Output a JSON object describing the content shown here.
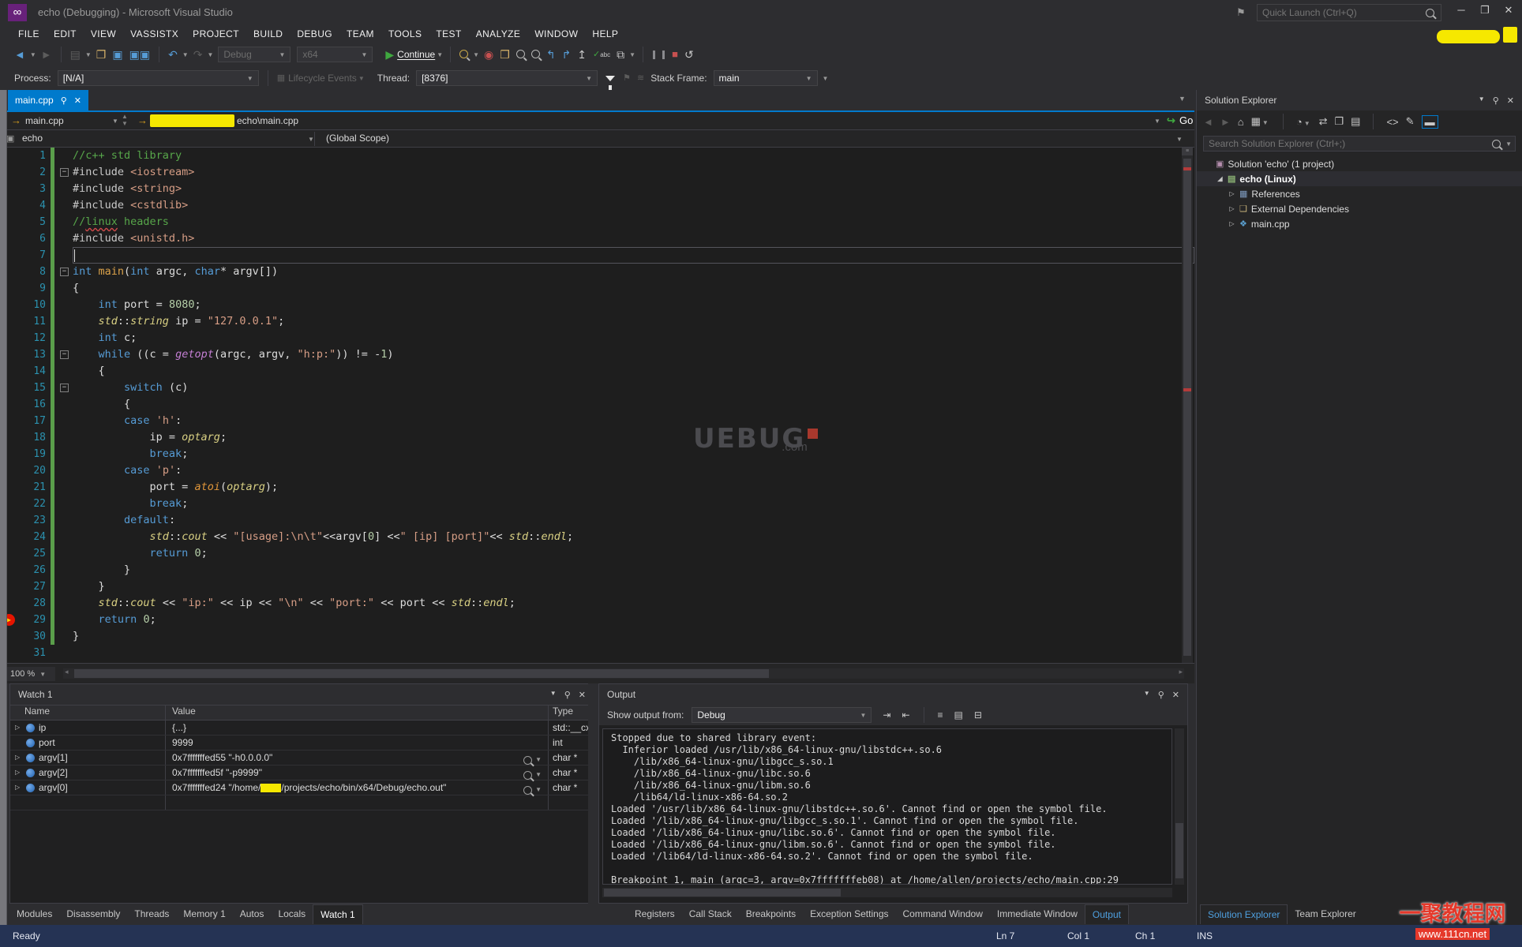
{
  "window": {
    "title": "echo (Debugging) - Microsoft Visual Studio",
    "quick_launch_placeholder": "Quick Launch (Ctrl+Q)"
  },
  "menu": [
    "FILE",
    "EDIT",
    "VIEW",
    "VASSISTX",
    "PROJECT",
    "BUILD",
    "DEBUG",
    "TEAM",
    "TOOLS",
    "TEST",
    "ANALYZE",
    "WINDOW",
    "HELP"
  ],
  "toolbar": {
    "configuration": "Debug",
    "platform": "x64",
    "continue_label": "Continue"
  },
  "debug_bar": {
    "process_label": "Process:",
    "process_value": "[N/A]",
    "lifecycle_label": "Lifecycle Events",
    "thread_label": "Thread:",
    "thread_value": "[8376]",
    "stack_frame_label": "Stack Frame:",
    "stack_frame_value": "main"
  },
  "editor": {
    "tab_label": "main.cpp",
    "nav_file": "main.cpp",
    "nav_path_suffix": "echo\\main.cpp",
    "scope_project": "echo",
    "scope_global": "(Global Scope)",
    "go_label": "Go",
    "zoom_level": "100 %",
    "lines": [
      {
        "n": 1,
        "t": [
          [
            "cm",
            "//c++ std library"
          ]
        ]
      },
      {
        "n": 2,
        "fold": true,
        "t": [
          [
            "pp",
            "#include "
          ],
          [
            "str",
            "<iostream>"
          ]
        ]
      },
      {
        "n": 3,
        "t": [
          [
            "pp",
            "#include "
          ],
          [
            "str",
            "<string>"
          ]
        ]
      },
      {
        "n": 4,
        "t": [
          [
            "pp",
            "#include "
          ],
          [
            "str",
            "<cstdlib>"
          ]
        ]
      },
      {
        "n": 5,
        "t": [
          [
            "cm",
            "//"
          ],
          [
            "cmsq",
            "linux"
          ],
          [
            "cm",
            " headers"
          ]
        ]
      },
      {
        "n": 6,
        "t": [
          [
            "pp",
            "#include "
          ],
          [
            "str",
            "<unistd.h>"
          ]
        ]
      },
      {
        "n": 7,
        "cur": true,
        "t": []
      },
      {
        "n": 8,
        "fold": true,
        "t": [
          [
            "kw",
            "int "
          ],
          [
            "fn",
            "main"
          ],
          [
            "pl",
            "("
          ],
          [
            "kw",
            "int"
          ],
          [
            "pl",
            " argc, "
          ],
          [
            "kw",
            "char"
          ],
          [
            "pl",
            "* argv[])"
          ]
        ]
      },
      {
        "n": 9,
        "t": [
          [
            "pl",
            "{"
          ]
        ]
      },
      {
        "n": 10,
        "t": [
          [
            "pl",
            "    "
          ],
          [
            "kw",
            "int"
          ],
          [
            "pl",
            " port = "
          ],
          [
            "num",
            "8080"
          ],
          [
            "pl",
            ";"
          ]
        ]
      },
      {
        "n": 11,
        "t": [
          [
            "pl",
            "    "
          ],
          [
            "va",
            "std"
          ],
          [
            "pl",
            "::"
          ],
          [
            "va",
            "string"
          ],
          [
            "pl",
            " ip = "
          ],
          [
            "str",
            "\"127.0.0.1\""
          ],
          [
            "pl",
            ";"
          ]
        ]
      },
      {
        "n": 12,
        "t": [
          [
            "pl",
            "    "
          ],
          [
            "kw",
            "int"
          ],
          [
            "pl",
            " c;"
          ]
        ]
      },
      {
        "n": 13,
        "fold": true,
        "t": [
          [
            "pl",
            "    "
          ],
          [
            "kw",
            "while"
          ],
          [
            "pl",
            " ((c = "
          ],
          [
            "mg",
            "getopt"
          ],
          [
            "pl",
            "(argc, argv, "
          ],
          [
            "str",
            "\"h:p:\""
          ],
          [
            "pl",
            ")) != -"
          ],
          [
            "num",
            "1"
          ],
          [
            "pl",
            ")"
          ]
        ]
      },
      {
        "n": 14,
        "t": [
          [
            "pl",
            "    {"
          ]
        ]
      },
      {
        "n": 15,
        "fold": true,
        "t": [
          [
            "pl",
            "        "
          ],
          [
            "kw",
            "switch"
          ],
          [
            "pl",
            " (c)"
          ]
        ]
      },
      {
        "n": 16,
        "t": [
          [
            "pl",
            "        {"
          ]
        ]
      },
      {
        "n": 17,
        "t": [
          [
            "pl",
            "        "
          ],
          [
            "kw",
            "case"
          ],
          [
            "pl",
            " "
          ],
          [
            "str",
            "'h'"
          ],
          [
            "pl",
            ":"
          ]
        ]
      },
      {
        "n": 18,
        "t": [
          [
            "pl",
            "            ip = "
          ],
          [
            "va",
            "optarg"
          ],
          [
            "pl",
            ";"
          ]
        ]
      },
      {
        "n": 19,
        "t": [
          [
            "pl",
            "            "
          ],
          [
            "kw",
            "break"
          ],
          [
            "pl",
            ";"
          ]
        ]
      },
      {
        "n": 20,
        "t": [
          [
            "pl",
            "        "
          ],
          [
            "kw",
            "case"
          ],
          [
            "pl",
            " "
          ],
          [
            "str",
            "'p'"
          ],
          [
            "pl",
            ":"
          ]
        ]
      },
      {
        "n": 21,
        "t": [
          [
            "pl",
            "            port = "
          ],
          [
            "or",
            "atoi"
          ],
          [
            "pl",
            "("
          ],
          [
            "va",
            "optarg"
          ],
          [
            "pl",
            ");"
          ]
        ]
      },
      {
        "n": 22,
        "t": [
          [
            "pl",
            "            "
          ],
          [
            "kw",
            "break"
          ],
          [
            "pl",
            ";"
          ]
        ]
      },
      {
        "n": 23,
        "t": [
          [
            "pl",
            "        "
          ],
          [
            "kw",
            "default"
          ],
          [
            "pl",
            ":"
          ]
        ]
      },
      {
        "n": 24,
        "t": [
          [
            "pl",
            "            "
          ],
          [
            "va",
            "std"
          ],
          [
            "pl",
            "::"
          ],
          [
            "va",
            "cout"
          ],
          [
            "pl",
            " << "
          ],
          [
            "str",
            "\"[usage]:\\n\\t\""
          ],
          [
            "pl",
            "<<argv["
          ],
          [
            "num",
            "0"
          ],
          [
            "pl",
            "] <<"
          ],
          [
            "str",
            "\" [ip] [port]\""
          ],
          [
            "pl",
            "<< "
          ],
          [
            "va",
            "std"
          ],
          [
            "pl",
            "::"
          ],
          [
            "va",
            "endl"
          ],
          [
            "pl",
            ";"
          ]
        ]
      },
      {
        "n": 25,
        "t": [
          [
            "pl",
            "            "
          ],
          [
            "kw",
            "return"
          ],
          [
            "pl",
            " "
          ],
          [
            "num",
            "0"
          ],
          [
            "pl",
            ";"
          ]
        ]
      },
      {
        "n": 26,
        "t": [
          [
            "pl",
            "        }"
          ]
        ]
      },
      {
        "n": 27,
        "t": [
          [
            "pl",
            "    }"
          ]
        ]
      },
      {
        "n": 28,
        "t": [
          [
            "pl",
            "    "
          ],
          [
            "va",
            "std"
          ],
          [
            "pl",
            "::"
          ],
          [
            "va",
            "cout"
          ],
          [
            "pl",
            " << "
          ],
          [
            "str",
            "\"ip:\""
          ],
          [
            "pl",
            " << ip << "
          ],
          [
            "str",
            "\"\\n\""
          ],
          [
            "pl",
            " << "
          ],
          [
            "str",
            "\"port:\""
          ],
          [
            "pl",
            " << port << "
          ],
          [
            "va",
            "std"
          ],
          [
            "pl",
            "::"
          ],
          [
            "va",
            "endl"
          ],
          [
            "pl",
            ";"
          ]
        ]
      },
      {
        "n": 29,
        "bp": true,
        "t": [
          [
            "pl",
            "    "
          ],
          [
            "kw",
            "return"
          ],
          [
            "pl",
            " "
          ],
          [
            "num",
            "0"
          ],
          [
            "pl",
            ";"
          ]
        ]
      },
      {
        "n": 30,
        "t": [
          [
            "pl",
            "}"
          ]
        ]
      },
      {
        "n": 31,
        "t": []
      }
    ]
  },
  "center_watermark": {
    "brand": "UEBUG",
    "suffix": ".com"
  },
  "watch": {
    "title": "Watch 1",
    "columns": [
      "Name",
      "Value",
      "Type"
    ],
    "rows": [
      {
        "expand": true,
        "name": "ip",
        "value": [
          {
            "t": "{...}"
          }
        ],
        "type": "std::__cx"
      },
      {
        "expand": false,
        "name": "port",
        "value": [
          {
            "t": "9999"
          }
        ],
        "type": "int"
      },
      {
        "expand": true,
        "name": "argv[1]",
        "value": [
          {
            "t": "0x7fffffffed55 \"-h0.0.0.0\""
          }
        ],
        "type": "char *",
        "mag": true
      },
      {
        "expand": true,
        "name": "argv[2]",
        "value": [
          {
            "t": "0x7fffffffed5f \"-p9999\""
          }
        ],
        "type": "char *",
        "mag": true
      },
      {
        "expand": true,
        "name": "argv[0]",
        "value": [
          {
            "t": "0x7fffffffed24 \"/home/"
          },
          {
            "redact": true
          },
          {
            "t": "/projects/echo/bin/x64/Debug/echo.out\""
          }
        ],
        "type": "char *",
        "mag": true
      }
    ]
  },
  "output": {
    "title": "Output",
    "show_output_label": "Show output from:",
    "source": "Debug",
    "lines": [
      "Stopped due to shared library event:",
      "  Inferior loaded /usr/lib/x86_64-linux-gnu/libstdc++.so.6",
      "    /lib/x86_64-linux-gnu/libgcc_s.so.1",
      "    /lib/x86_64-linux-gnu/libc.so.6",
      "    /lib/x86_64-linux-gnu/libm.so.6",
      "    /lib64/ld-linux-x86-64.so.2",
      "Loaded '/usr/lib/x86_64-linux-gnu/libstdc++.so.6'. Cannot find or open the symbol file.",
      "Loaded '/lib/x86_64-linux-gnu/libgcc_s.so.1'. Cannot find or open the symbol file.",
      "Loaded '/lib/x86_64-linux-gnu/libc.so.6'. Cannot find or open the symbol file.",
      "Loaded '/lib/x86_64-linux-gnu/libm.so.6'. Cannot find or open the symbol file.",
      "Loaded '/lib64/ld-linux-x86-64.so.2'. Cannot find or open the symbol file.",
      "",
      "Breakpoint 1, main (argc=3, argv=0x7fffffffeb08) at /home/allen/projects/echo/main.cpp:29"
    ]
  },
  "panel_tabs": {
    "left": [
      {
        "label": "Modules"
      },
      {
        "label": "Disassembly"
      },
      {
        "label": "Threads"
      },
      {
        "label": "Memory 1"
      },
      {
        "label": "Autos"
      },
      {
        "label": "Locals"
      },
      {
        "label": "Watch 1",
        "active": true
      }
    ],
    "middle": [
      {
        "label": "Registers"
      },
      {
        "label": "Call Stack"
      },
      {
        "label": "Breakpoints"
      },
      {
        "label": "Exception Settings"
      },
      {
        "label": "Command Window"
      },
      {
        "label": "Immediate Window"
      },
      {
        "label": "Output",
        "active": true
      }
    ],
    "right": [
      {
        "label": "Solution Explorer",
        "active": true
      },
      {
        "label": "Team Explorer"
      }
    ]
  },
  "solution_explorer": {
    "title": "Solution Explorer",
    "search_placeholder": "Search Solution Explorer (Ctrl+;)",
    "tree": [
      {
        "label": "Solution 'echo' (1 project)",
        "icon": "solution",
        "indent": 0
      },
      {
        "label": "echo (Linux)",
        "icon": "project",
        "indent": 1,
        "expanded": true,
        "bold": true
      },
      {
        "label": "References",
        "icon": "references",
        "indent": 2,
        "collapsible": true
      },
      {
        "label": "External Dependencies",
        "icon": "folder",
        "indent": 2,
        "collapsible": true
      },
      {
        "label": "main.cpp",
        "icon": "cpp-file",
        "indent": 2,
        "collapsible": true
      }
    ]
  },
  "status_bar": {
    "ready": "Ready",
    "ln": "Ln 7",
    "col": "Col 1",
    "ch": "Ch 1",
    "ins": "INS"
  },
  "corner_watermark": {
    "line1": "一聚教程网",
    "line2": "www.111cn.net"
  },
  "colors": {
    "accent": "#007acc",
    "status_bg": "#253354",
    "breakpoint": "#e51400",
    "change_bar": "#5a9e4a",
    "tab_active": "#007acc"
  }
}
